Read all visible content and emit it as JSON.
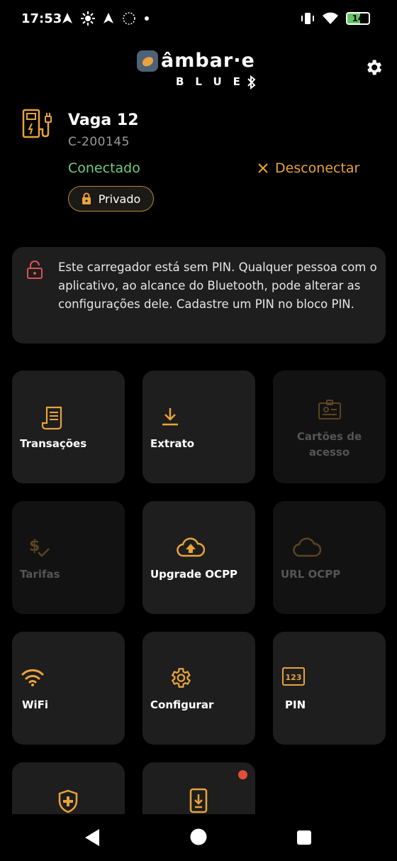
{
  "status_bar": {
    "time": "17:53",
    "battery_level": "14",
    "icons": [
      "navigation-icon",
      "brightness-icon",
      "navigation-icon",
      "sim-icon",
      "dot-icon",
      "vibrate-icon",
      "wifi-icon",
      "battery-charging-icon"
    ]
  },
  "header": {
    "logo_text": "âmbar·e",
    "logo_subtext": "BLUE",
    "settings_icon": "gear-icon"
  },
  "charger": {
    "name": "Vaga 12",
    "id": "C-200145",
    "status": "Conectado",
    "disconnect_label": "Desconectar",
    "privacy_label": "Privado"
  },
  "warning": {
    "text": "Este carregador está sem PIN. Qualquer pessoa com o aplicativo, ao alcance do Bluetooth, pode alterar as configurações dele. Cadastre um PIN no bloco PIN."
  },
  "tiles": [
    {
      "label": "Transações",
      "icon": "receipt-icon",
      "enabled": true
    },
    {
      "label": "Extrato",
      "icon": "download-icon",
      "enabled": true
    },
    {
      "label": "Cartões de acesso",
      "icon": "id-card-icon",
      "enabled": false
    },
    {
      "label": "Tarifas",
      "icon": "dollar-check-icon",
      "enabled": false
    },
    {
      "label": "Upgrade OCPP",
      "icon": "cloud-upload-icon",
      "enabled": true
    },
    {
      "label": "URL OCPP",
      "icon": "cloud-icon",
      "enabled": false
    },
    {
      "label": "WiFi",
      "icon": "wifi-icon",
      "enabled": true
    },
    {
      "label": "Configurar",
      "icon": "gear-icon",
      "enabled": true
    },
    {
      "label": "PIN",
      "icon": "pin-123-icon",
      "enabled": true
    },
    {
      "label": "",
      "icon": "shield-plus-icon",
      "enabled": true
    },
    {
      "label": "",
      "icon": "phone-download-icon",
      "enabled": true,
      "notification": true
    }
  ],
  "colors": {
    "accent": "#E8A33D",
    "connected": "#6FCF7F",
    "card": "#1E1E1E",
    "disabled_card": "#121212",
    "notification": "#E54C3C"
  }
}
